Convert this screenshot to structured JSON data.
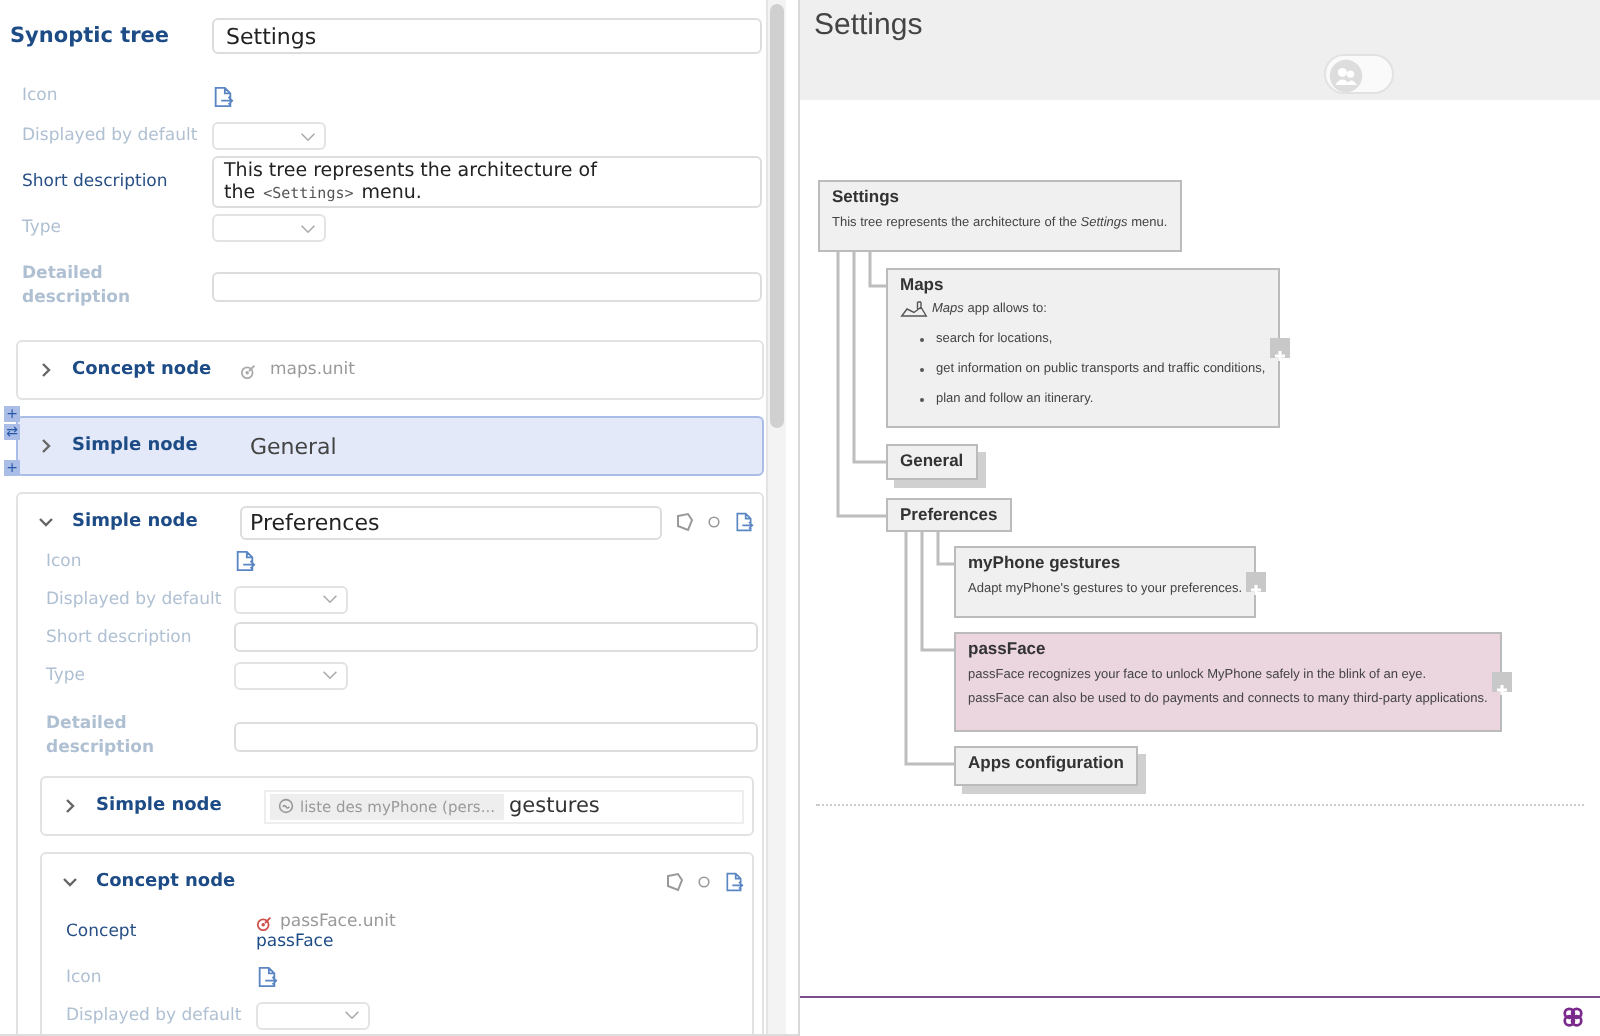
{
  "editor": {
    "header": {
      "label": "Synoptic tree",
      "value": "Settings"
    },
    "fields": [
      {
        "kind": "icon",
        "label": "Icon",
        "filled": false
      },
      {
        "kind": "select",
        "label": "Displayed by default",
        "filled": false
      },
      {
        "kind": "textarea",
        "label": "Short description",
        "filled": true,
        "value": "This tree represents the architecture of the",
        "reference": "<Settings>",
        "value_end": "menu."
      },
      {
        "kind": "select",
        "label": "Type",
        "filled": false
      },
      {
        "kind": "long_text",
        "label": "Detailed description",
        "filled": false
      }
    ],
    "nodes": [
      {
        "kind": "concept",
        "title": "Concept node",
        "expanded": false,
        "selected": false,
        "concept": "maps.unit"
      },
      {
        "kind": "simple",
        "title": "Simple node",
        "expanded": false,
        "selected": true,
        "value": "General"
      },
      {
        "kind": "simple",
        "title": "Simple node",
        "expanded": true,
        "selected": false,
        "value": "Preferences",
        "fields": [
          {
            "kind": "icon",
            "label": "Icon",
            "filled": false
          },
          {
            "kind": "select",
            "label": "Displayed by default",
            "filled": false
          },
          {
            "kind": "textarea",
            "label": "Short description",
            "filled": false
          },
          {
            "kind": "select",
            "label": "Type",
            "filled": false
          },
          {
            "kind": "long_text",
            "label": "Detailed description",
            "filled": false
          }
        ],
        "children": [
          {
            "kind": "simple",
            "title": "Simple node",
            "expanded": false,
            "selected": false,
            "tag": "liste des myPhone (pers...",
            "value": "gestures"
          },
          {
            "kind": "concept",
            "title": "Concept node",
            "expanded": true,
            "selected": false,
            "fields": [
              {
                "kind": "concept",
                "label": "Concept",
                "filled": true,
                "unit": "passFace.unit",
                "link": "passFace"
              },
              {
                "kind": "icon",
                "label": "Icon",
                "filled": false
              },
              {
                "kind": "select",
                "label": "Displayed by default",
                "filled": false
              }
            ]
          }
        ]
      }
    ],
    "side_buttons": [
      "+",
      "⇄",
      "+"
    ]
  },
  "preview": {
    "title": "Settings",
    "toggle_on": false,
    "tree": {
      "title": "Settings",
      "color": "#f0f0f0",
      "stacked": false,
      "paragraphs": [
        "This tree represents the architecture of the *Settings* menu."
      ],
      "children": [
        {
          "title": "Maps",
          "color": "#f0f0f0",
          "stacked": false,
          "expand_button": true,
          "has_icon": true,
          "lead": "*Maps* app allows to:",
          "bullets": [
            "search for locations,",
            "get information on public transports and traffic conditions,",
            "plan and follow an itinerary."
          ]
        },
        {
          "title": "General",
          "color": "#f0f0f0",
          "stacked": true
        },
        {
          "title": "Preferences",
          "color": "#f0f0f0",
          "stacked": false,
          "children": [
            {
              "title": "myPhone gestures",
              "color": "#f0f0f0",
              "stacked": false,
              "expand_button": true,
              "paragraphs": [
                "Adapt myPhone's gestures to your preferences."
              ]
            },
            {
              "title": "passFace",
              "color": "#ebd5df",
              "stacked": false,
              "expand_button": true,
              "paragraphs": [
                "passFace recognizes your face to unlock MyPhone safely in the blink of an eye.",
                "passFace can also be used to do payments and connects to many third-party applications."
              ]
            },
            {
              "title": "Apps configuration",
              "color": "#f0f0f0",
              "stacked": true
            }
          ]
        }
      ]
    }
  }
}
